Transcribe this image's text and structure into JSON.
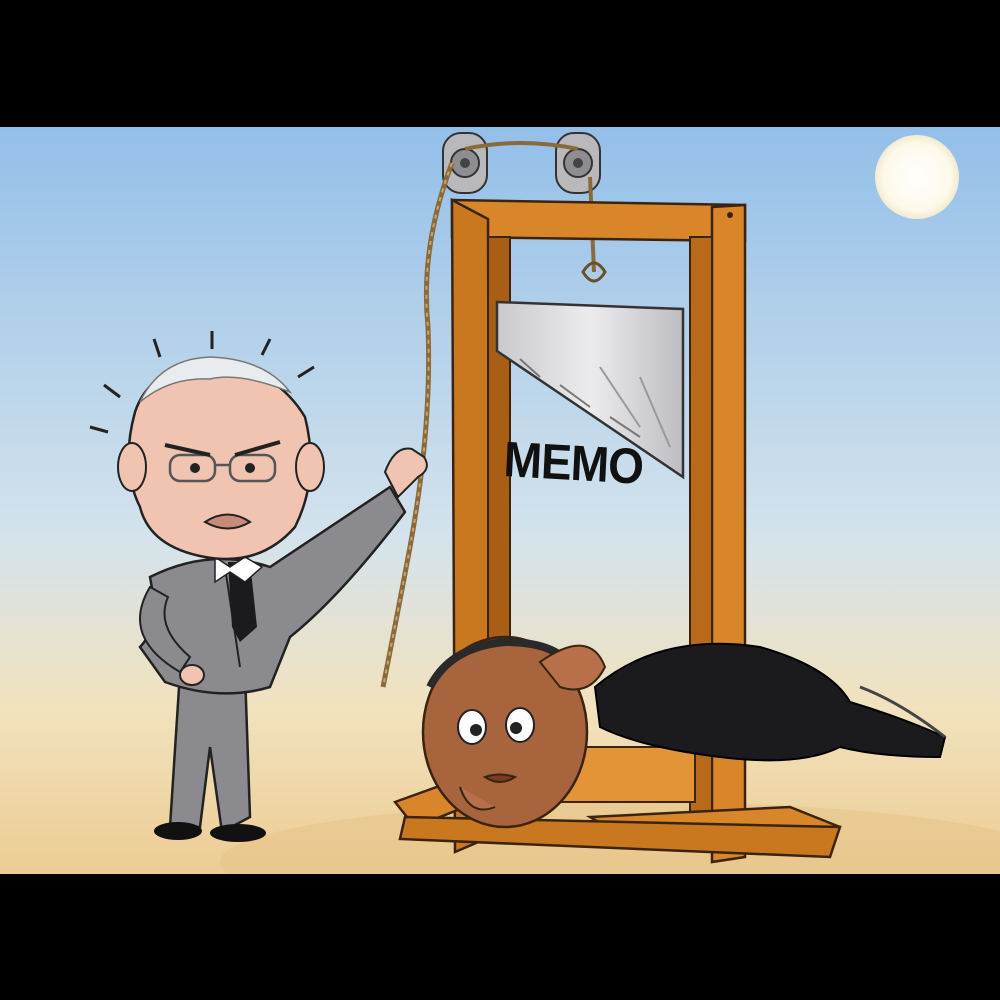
{
  "cartoon": {
    "blade_label": "MEMO"
  },
  "colors": {
    "sky_top": "#9fc6ea",
    "sky_bottom": "#f3e0b4",
    "ground": "#e9c98f",
    "wood": "#d9862a",
    "wood_dark": "#9b5a17",
    "blade": "#d9d9dc",
    "suit_grey": "#8b8b8f",
    "suit_black": "#1b1b1d",
    "skin_light": "#f1c3b1",
    "skin_dark": "#a8643c",
    "sun": "#fdfbf2"
  }
}
